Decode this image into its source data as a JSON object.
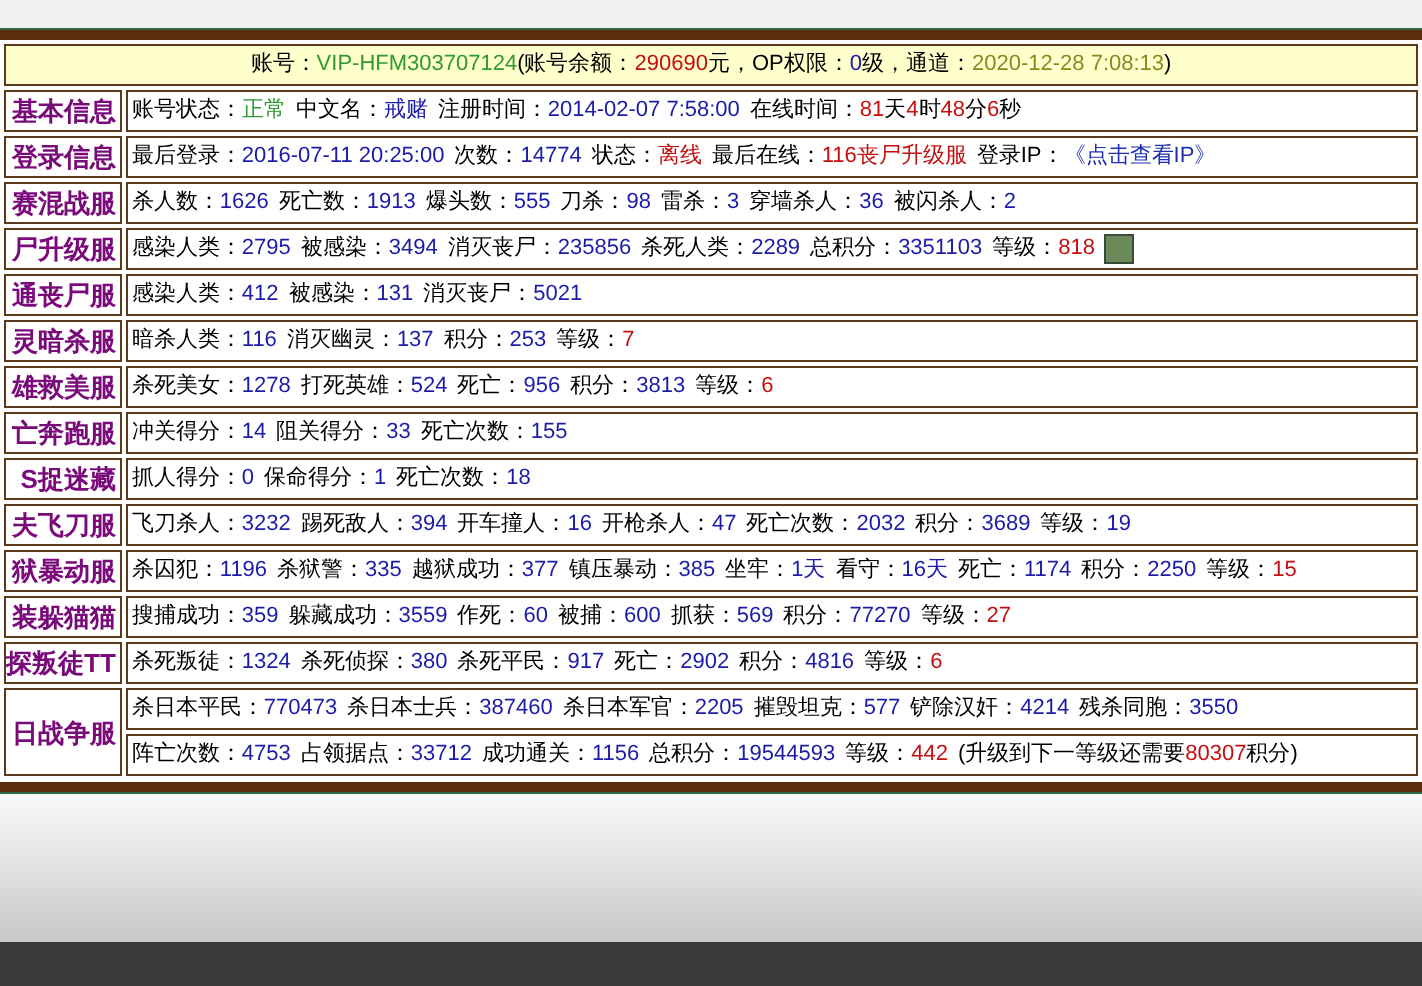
{
  "header": [
    {
      "text": "账号：",
      "color": "#000000"
    },
    {
      "text": "VIP-HFM303707124",
      "color": "#2f9a2f"
    },
    {
      "text": "(账号余额：",
      "color": "#000000"
    },
    {
      "text": "290690",
      "color": "#c41010"
    },
    {
      "text": "元，OP权限：",
      "color": "#000000"
    },
    {
      "text": "0",
      "color": "#1c1ca8"
    },
    {
      "text": "级，通道：",
      "color": "#000000"
    },
    {
      "text": "2020-12-28 7:08:13",
      "color": "#8c8a1e"
    },
    {
      "text": ")",
      "color": "#000000"
    }
  ],
  "rows": [
    {
      "label": "基本信息",
      "photo": false,
      "lines": [
        [
          {
            "label": "账号状态：",
            "value": "正常",
            "color": "#2f9a2f"
          },
          {
            "label": "中文名：",
            "value": "戒赌",
            "color": "#1c1ca8"
          },
          {
            "label": "注册时间：",
            "value": "2014-02-07 7:58:00",
            "color": "#1c1ca8"
          },
          {
            "label": "在线时间：",
            "parts": [
              {
                "text": "81",
                "color": "#c41010"
              },
              {
                "text": "天",
                "color": "#000000"
              },
              {
                "text": "4",
                "color": "#c41010"
              },
              {
                "text": "时",
                "color": "#000000"
              },
              {
                "text": "48",
                "color": "#c41010"
              },
              {
                "text": "分",
                "color": "#000000"
              },
              {
                "text": "6",
                "color": "#c41010"
              },
              {
                "text": "秒",
                "color": "#000000"
              }
            ]
          }
        ]
      ]
    },
    {
      "label": "登录信息",
      "photo": false,
      "lines": [
        [
          {
            "label": "最后登录：",
            "value": "2016-07-11 20:25:00",
            "color": "#1c1ca8"
          },
          {
            "label": "次数：",
            "value": "14774",
            "color": "#1c1ca8"
          },
          {
            "label": "状态：",
            "value": "离线",
            "color": "#c41010"
          },
          {
            "label": "最后在线：",
            "value": "116丧尸升级服",
            "color": "#c41010"
          },
          {
            "label": "登录IP：",
            "value": "《点击查看IP》",
            "color": "#2030b0"
          }
        ]
      ]
    },
    {
      "label": "赛混战服",
      "photo": false,
      "lines": [
        [
          {
            "label": "杀人数：",
            "value": "1626",
            "color": "#1c1ca8"
          },
          {
            "label": "死亡数：",
            "value": "1913",
            "color": "#1c1ca8"
          },
          {
            "label": "爆头数：",
            "value": "555",
            "color": "#1c1ca8"
          },
          {
            "label": "刀杀：",
            "value": "98",
            "color": "#1c1ca8"
          },
          {
            "label": "雷杀：",
            "value": "3",
            "color": "#1c1ca8"
          },
          {
            "label": "穿墙杀人：",
            "value": "36",
            "color": "#1c1ca8"
          },
          {
            "label": "被闪杀人：",
            "value": "2",
            "color": "#1c1ca8"
          }
        ]
      ]
    },
    {
      "label": "尸升级服",
      "photo": true,
      "lines": [
        [
          {
            "label": "感染人类：",
            "value": "2795",
            "color": "#1c1ca8"
          },
          {
            "label": "被感染：",
            "value": "3494",
            "color": "#1c1ca8"
          },
          {
            "label": "消灭丧尸：",
            "value": "235856",
            "color": "#1c1ca8"
          },
          {
            "label": "杀死人类：",
            "value": "2289",
            "color": "#1c1ca8"
          },
          {
            "label": "总积分：",
            "value": "3351103",
            "color": "#1c1ca8"
          },
          {
            "label": "等级：",
            "value": "818",
            "color": "#c41010"
          }
        ]
      ]
    },
    {
      "label": "通丧尸服",
      "photo": false,
      "lines": [
        [
          {
            "label": "感染人类：",
            "value": "412",
            "color": "#1c1ca8"
          },
          {
            "label": "被感染：",
            "value": "131",
            "color": "#1c1ca8"
          },
          {
            "label": "消灭丧尸：",
            "value": "5021",
            "color": "#1c1ca8"
          }
        ]
      ]
    },
    {
      "label": "灵暗杀服",
      "photo": false,
      "lines": [
        [
          {
            "label": "暗杀人类：",
            "value": "116",
            "color": "#1c1ca8"
          },
          {
            "label": "消灭幽灵：",
            "value": "137",
            "color": "#1c1ca8"
          },
          {
            "label": "积分：",
            "value": "253",
            "color": "#1c1ca8"
          },
          {
            "label": "等级：",
            "value": "7",
            "color": "#c41010"
          }
        ]
      ]
    },
    {
      "label": "雄救美服",
      "photo": false,
      "lines": [
        [
          {
            "label": "杀死美女：",
            "value": "1278",
            "color": "#1c1ca8"
          },
          {
            "label": "打死英雄：",
            "value": "524",
            "color": "#1c1ca8"
          },
          {
            "label": "死亡：",
            "value": "956",
            "color": "#1c1ca8"
          },
          {
            "label": "积分：",
            "value": "3813",
            "color": "#1c1ca8"
          },
          {
            "label": "等级：",
            "value": "6",
            "color": "#c41010"
          }
        ]
      ]
    },
    {
      "label": "亡奔跑服",
      "photo": false,
      "lines": [
        [
          {
            "label": "冲关得分：",
            "value": "14",
            "color": "#1c1ca8"
          },
          {
            "label": "阻关得分：",
            "value": "33",
            "color": "#1c1ca8"
          },
          {
            "label": "死亡次数：",
            "value": "155",
            "color": "#1c1ca8"
          }
        ]
      ]
    },
    {
      "label": "S捉迷藏",
      "photo": false,
      "lines": [
        [
          {
            "label": "抓人得分：",
            "value": "0",
            "color": "#1c1ca8"
          },
          {
            "label": "保命得分：",
            "value": "1",
            "color": "#1c1ca8"
          },
          {
            "label": "死亡次数：",
            "value": "18",
            "color": "#1c1ca8"
          }
        ]
      ]
    },
    {
      "label": "夫飞刀服",
      "photo": false,
      "lines": [
        [
          {
            "label": "飞刀杀人：",
            "value": "3232",
            "color": "#1c1ca8"
          },
          {
            "label": "踢死敌人：",
            "value": "394",
            "color": "#1c1ca8"
          },
          {
            "label": "开车撞人：",
            "value": "16",
            "color": "#1c1ca8"
          },
          {
            "label": "开枪杀人：",
            "value": "47",
            "color": "#1c1ca8"
          },
          {
            "label": "死亡次数：",
            "value": "2032",
            "color": "#1c1ca8"
          },
          {
            "label": "积分：",
            "value": "3689",
            "color": "#1c1ca8"
          },
          {
            "label": "等级：",
            "value": "19",
            "color": "#1c1ca8"
          }
        ]
      ]
    },
    {
      "label": "狱暴动服",
      "photo": false,
      "lines": [
        [
          {
            "label": "杀囚犯：",
            "value": "1196",
            "color": "#1c1ca8"
          },
          {
            "label": "杀狱警：",
            "value": "335",
            "color": "#1c1ca8"
          },
          {
            "label": "越狱成功：",
            "value": "377",
            "color": "#1c1ca8"
          },
          {
            "label": "镇压暴动：",
            "value": "385",
            "color": "#1c1ca8"
          },
          {
            "label": "坐牢：",
            "value": "1天",
            "color": "#1c1ca8"
          },
          {
            "label": "看守：",
            "value": "16天",
            "color": "#1c1ca8"
          },
          {
            "label": "死亡：",
            "value": "1174",
            "color": "#1c1ca8"
          },
          {
            "label": "积分：",
            "value": "2250",
            "color": "#1c1ca8"
          },
          {
            "label": "等级：",
            "value": "15",
            "color": "#c41010"
          }
        ]
      ]
    },
    {
      "label": "装躲猫猫",
      "photo": false,
      "lines": [
        [
          {
            "label": "搜捕成功：",
            "value": "359",
            "color": "#1c1ca8"
          },
          {
            "label": "躲藏成功：",
            "value": "3559",
            "color": "#1c1ca8"
          },
          {
            "label": "作死：",
            "value": "60",
            "color": "#1c1ca8"
          },
          {
            "label": "被捕：",
            "value": "600",
            "color": "#1c1ca8"
          },
          {
            "label": "抓获：",
            "value": "569",
            "color": "#1c1ca8"
          },
          {
            "label": "积分：",
            "value": "77270",
            "color": "#1c1ca8"
          },
          {
            "label": "等级：",
            "value": "27",
            "color": "#c41010"
          }
        ]
      ]
    },
    {
      "label": "探叛徒TT",
      "photo": false,
      "lines": [
        [
          {
            "label": "杀死叛徒：",
            "value": "1324",
            "color": "#1c1ca8"
          },
          {
            "label": "杀死侦探：",
            "value": "380",
            "color": "#1c1ca8"
          },
          {
            "label": "杀死平民：",
            "value": "917",
            "color": "#1c1ca8"
          },
          {
            "label": "死亡：",
            "value": "2902",
            "color": "#1c1ca8"
          },
          {
            "label": "积分：",
            "value": "4816",
            "color": "#1c1ca8"
          },
          {
            "label": "等级：",
            "value": "6",
            "color": "#c41010"
          }
        ]
      ]
    },
    {
      "label": "日战争服",
      "photo": false,
      "lines": [
        [
          {
            "label": "杀日本平民：",
            "value": "770473",
            "color": "#1c1ca8"
          },
          {
            "label": "杀日本士兵：",
            "value": "387460",
            "color": "#1c1ca8"
          },
          {
            "label": "杀日本军官：",
            "value": "2205",
            "color": "#1c1ca8"
          },
          {
            "label": "摧毁坦克：",
            "value": "577",
            "color": "#1c1ca8"
          },
          {
            "label": "铲除汉奸：",
            "value": "4214",
            "color": "#1c1ca8"
          },
          {
            "label": "残杀同胞：",
            "value": "3550",
            "color": "#1c1ca8"
          }
        ],
        [
          {
            "label": "阵亡次数：",
            "value": "4753",
            "color": "#1c1ca8"
          },
          {
            "label": "占领据点：",
            "value": "33712",
            "color": "#1c1ca8"
          },
          {
            "label": "成功通关：",
            "value": "1156",
            "color": "#1c1ca8"
          },
          {
            "label": "总积分：",
            "value": "19544593",
            "color": "#1c1ca8"
          },
          {
            "label": "等级：",
            "value": "442",
            "color": "#c41010"
          },
          {
            "label": "(升级到下一等级还需要",
            "parts": [
              {
                "text": "80307",
                "color": "#c41010"
              },
              {
                "text": "积分)",
                "color": "#000000"
              }
            ]
          }
        ]
      ]
    }
  ]
}
